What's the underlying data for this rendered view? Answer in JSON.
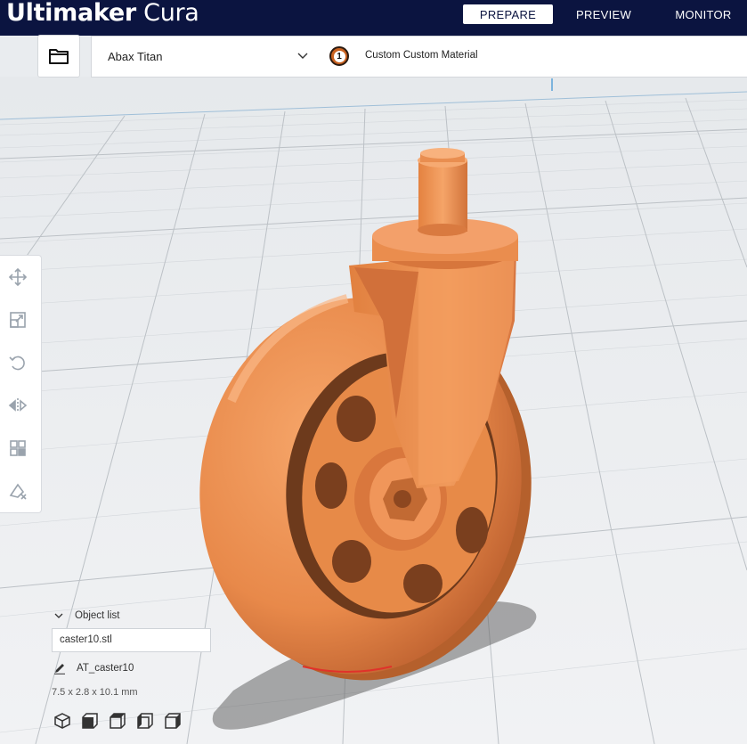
{
  "app": {
    "brand_bold": "Ultimaker",
    "brand_light": " Cura"
  },
  "stages": [
    {
      "label": "PREPARE",
      "active": true
    },
    {
      "label": "PREVIEW",
      "active": false
    },
    {
      "label": "MONITOR",
      "active": false
    }
  ],
  "header": {
    "open_icon": "folder-icon",
    "printer": "Abax Titan",
    "extruder_number": "1",
    "material": "Custom Custom Material"
  },
  "tools": [
    "move-icon",
    "scale-icon",
    "rotate-icon",
    "mirror-icon",
    "per-model-settings-icon",
    "support-blocker-icon"
  ],
  "object_list": {
    "header": "Object list",
    "file": "caster10.stl",
    "object_name": "AT_caster10",
    "dimensions": "7.5 x 2.8 x 10.1 mm"
  },
  "view_buttons": [
    "3d-view-icon",
    "front-view-icon",
    "top-view-icon",
    "left-view-icon",
    "right-view-icon"
  ],
  "colors": {
    "topbar": "#0b1440",
    "model": "#e8894a",
    "background": "#e9ecef"
  }
}
